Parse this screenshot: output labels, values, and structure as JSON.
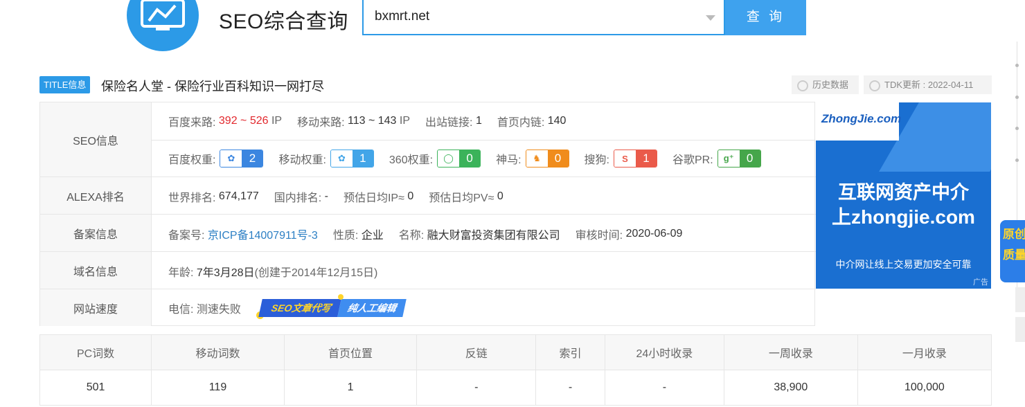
{
  "header": {
    "site_title": "SEO综合查询",
    "search_value": "bxmrt.net",
    "search_button": "查 询"
  },
  "title_line": {
    "badge": "TITLE信息",
    "text": "保险名人堂 - 保险行业百科知识一网打尽",
    "history_button": "历史数据",
    "tdk_update": "TDK更新 : 2022-04-11"
  },
  "seo": {
    "label": "SEO信息",
    "baidu_traffic_label": "百度来路:",
    "baidu_traffic_value": "392 ~ 526",
    "baidu_traffic_unit": "IP",
    "mobile_traffic_label": "移动来路:",
    "mobile_traffic_value": "113 ~ 143",
    "mobile_traffic_unit": "IP",
    "outbound_label": "出站链接:",
    "outbound_value": "1",
    "internal_label": "首页内链:",
    "internal_value": "140",
    "weights": [
      {
        "label": "百度权重:",
        "icon": "baidu-paw-icon",
        "value": "2"
      },
      {
        "label": "移动权重:",
        "icon": "baidu-mobile-paw-icon",
        "value": "1"
      },
      {
        "label": "360权重:",
        "icon": "360-icon",
        "value": "0"
      },
      {
        "label": "神马:",
        "icon": "shenma-icon",
        "value": "0"
      },
      {
        "label": "搜狗:",
        "icon": "sogou-icon",
        "value": "1"
      },
      {
        "label": "谷歌PR:",
        "icon": "google-plus-icon",
        "value": "0"
      }
    ]
  },
  "alexa": {
    "label": "ALEXA排名",
    "world_label": "世界排名:",
    "world_value": "674,177",
    "domestic_label": "国内排名:",
    "domestic_value": "-",
    "daily_ip_label": "预估日均IP≈",
    "daily_ip_value": "0",
    "daily_pv_label": "预估日均PV≈",
    "daily_pv_value": "0"
  },
  "icp": {
    "label": "备案信息",
    "num_label": "备案号:",
    "num_value": "京ICP备14007911号-3",
    "type_label": "性质:",
    "type_value": "企业",
    "name_label": "名称:",
    "name_value": "融大财富投资集团有限公司",
    "audit_label": "审核时间:",
    "audit_value": "2020-06-09"
  },
  "domain": {
    "label": "域名信息",
    "age_label": "年龄:",
    "age_value": "7年3月28日",
    "created": "(创建于2014年12月15日)"
  },
  "speed": {
    "label": "网站速度",
    "telecom_label": "电信:",
    "telecom_value": "测速失败",
    "promo_left": "SEO文章代写",
    "promo_right": "纯人工编辑"
  },
  "ad": {
    "logo": "ZhongJie.com",
    "line1": "互联网资产中介",
    "line2": "上zhongjie.com",
    "line3": "中介网让线上交易更加安全可靠",
    "tag": "广告"
  },
  "stats": {
    "headers": [
      "PC词数",
      "移动词数",
      "首页位置",
      "反链",
      "索引",
      "24小时收录",
      "一周收录",
      "一月收录"
    ],
    "values": [
      "501",
      "119",
      "1",
      "-",
      "-",
      "-",
      "38,900",
      "100,000"
    ]
  },
  "edge_float": {
    "line1": "原创",
    "line2": "质量"
  },
  "colors": {
    "accent": "#2c9ae7",
    "highlight": "#e2282d",
    "link": "#2c7fc4"
  }
}
